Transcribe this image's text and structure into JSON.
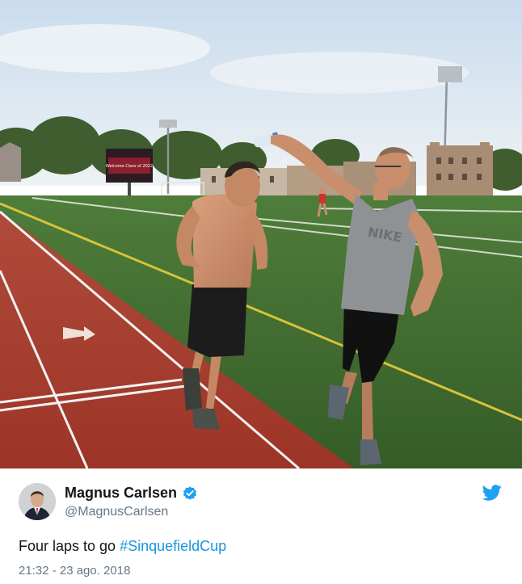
{
  "tweet": {
    "author": {
      "display_name": "Magnus Carlsen",
      "handle": "@MagnusCarlsen",
      "verified": true
    },
    "text": "Four laps to go ",
    "hashtag": "#SinquefieldCup",
    "timestamp": "21:32 - 23 ago. 2018"
  },
  "photo": {
    "scoreboard_text": "Welcome Class of 2022",
    "icon": "photo"
  },
  "colors": {
    "brand": "#1da1f2",
    "hashtag": "#1b95e0",
    "name": "#14171a",
    "secondary": "#657786",
    "track": "#a53a2b",
    "grass": "#3f6b2e"
  },
  "icons": {
    "verified": "verified-badge-icon",
    "brand": "twitter-bird-icon"
  }
}
